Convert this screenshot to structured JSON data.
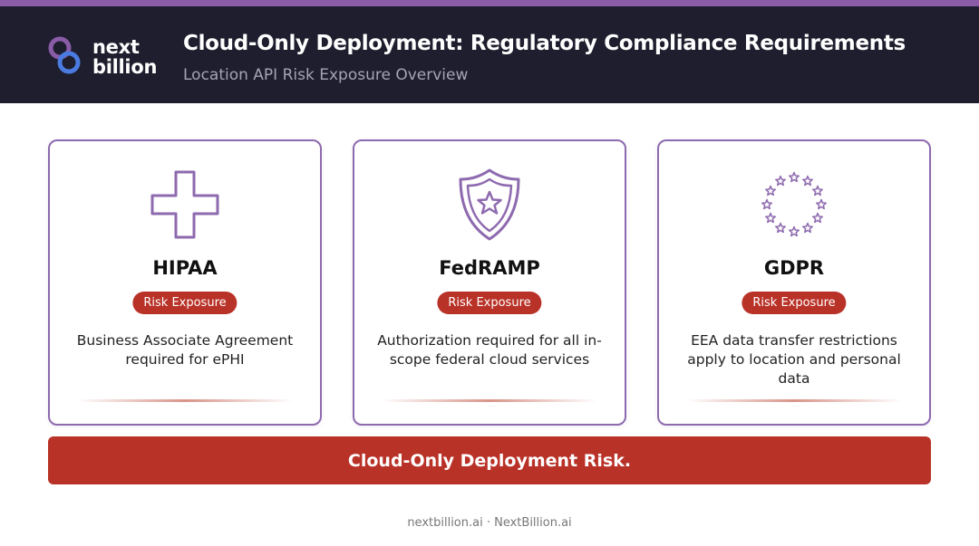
{
  "header": {
    "logo_text_line1": "next",
    "logo_text_line2": "billion",
    "title": "Cloud-Only Deployment: Regulatory Compliance Requirements",
    "subtitle": "Location API Risk Exposure Overview"
  },
  "colors": {
    "header_bg": "#1e1e2e",
    "accent_purple": "#8e6aaf",
    "risk_red": "#b93228"
  },
  "cards": [
    {
      "icon": "medical-cross-icon",
      "title": "HIPAA",
      "badge": "Risk Exposure",
      "description": "Business Associate Agreement required for ePHI"
    },
    {
      "icon": "shield-star-icon",
      "title": "FedRAMP",
      "badge": "Risk Exposure",
      "description": "Authorization required for all in-scope federal cloud services"
    },
    {
      "icon": "eu-stars-icon",
      "title": "GDPR",
      "badge": "Risk Exposure",
      "description": "EEA data transfer restrictions apply to location and personal data"
    }
  ],
  "risk_bar": {
    "text": "Cloud-Only Deployment Risk."
  },
  "footer": {
    "text": "nextbillion.ai · NextBillion.ai"
  }
}
